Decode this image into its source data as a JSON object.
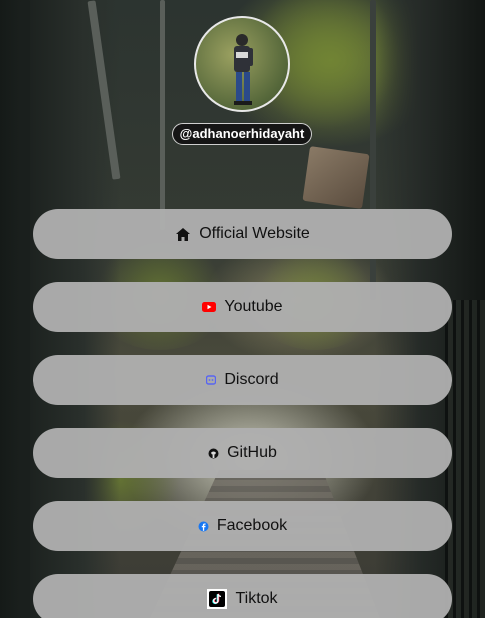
{
  "profile": {
    "handle": "@adhanoerhidayaht"
  },
  "links": [
    {
      "label": "Official Website",
      "icon": "home-icon",
      "color": "#111111"
    },
    {
      "label": "Youtube",
      "icon": "youtube-icon",
      "color": "#ff0000"
    },
    {
      "label": "Discord",
      "icon": "discord-icon",
      "color": "#5865f2"
    },
    {
      "label": "GitHub",
      "icon": "github-icon",
      "color": "#111111"
    },
    {
      "label": "Facebook",
      "icon": "facebook-icon",
      "color": "#1877f2"
    },
    {
      "label": "Tiktok",
      "icon": "tiktok-icon",
      "color": "#000000"
    }
  ]
}
